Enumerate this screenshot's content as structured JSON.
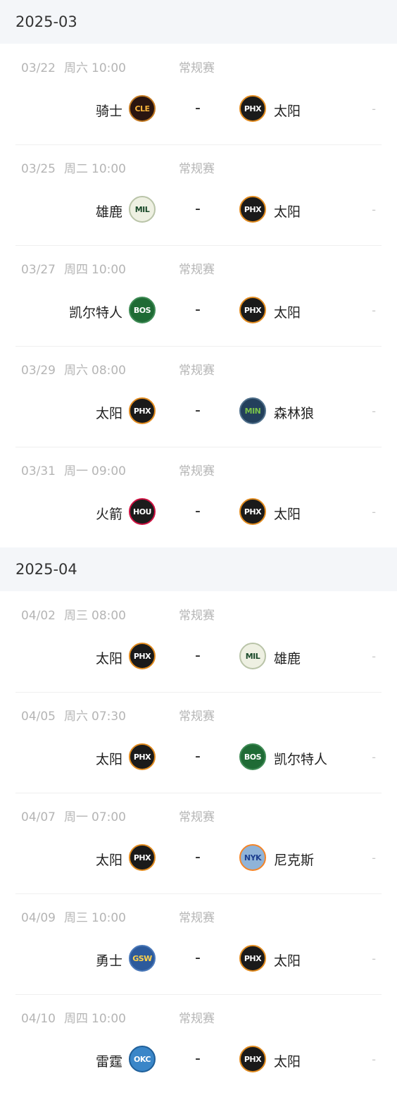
{
  "colors": {
    "CLE": {
      "bg": "#2a1510",
      "fg": "#f6b23a",
      "ring": "#c37a22"
    },
    "PHX": {
      "bg": "#1a1a1a",
      "fg": "#ffffff",
      "ring": "#e08a1e"
    },
    "MIL": {
      "bg": "#eef0e2",
      "fg": "#1b4a2a",
      "ring": "#b9c4a8"
    },
    "BOS": {
      "bg": "#1f6b35",
      "fg": "#ffffff",
      "ring": "#3f8b55"
    },
    "MIN": {
      "bg": "#23405c",
      "fg": "#79c24a",
      "ring": "#4f6f8a"
    },
    "HOU": {
      "bg": "#1c1c1c",
      "fg": "#ffffff",
      "ring": "#ce1141"
    },
    "NYK": {
      "bg": "#8fb3d8",
      "fg": "#1d3f8f",
      "ring": "#f58426"
    },
    "GSW": {
      "bg": "#2c5a9c",
      "fg": "#ffd24a",
      "ring": "#4a78b8"
    },
    "OKC": {
      "bg": "#3a86c8",
      "fg": "#ffffff",
      "ring": "#1f5f99"
    }
  },
  "months": [
    {
      "label": "2025-03",
      "games": [
        {
          "date": "03/22",
          "weekday": "周六",
          "time": "10:00",
          "type": "常规赛",
          "home": {
            "name": "骑士",
            "code": "CLE",
            "logo": "CLE"
          },
          "score": "-",
          "away": {
            "name": "太阳",
            "code": "PHX",
            "logo": "PHX"
          },
          "extra": "-"
        },
        {
          "date": "03/25",
          "weekday": "周二",
          "time": "10:00",
          "type": "常规赛",
          "home": {
            "name": "雄鹿",
            "code": "MIL",
            "logo": "MIL"
          },
          "score": "-",
          "away": {
            "name": "太阳",
            "code": "PHX",
            "logo": "PHX"
          },
          "extra": "-"
        },
        {
          "date": "03/27",
          "weekday": "周四",
          "time": "10:00",
          "type": "常规赛",
          "home": {
            "name": "凯尔特人",
            "code": "BOS",
            "logo": "BOS"
          },
          "score": "-",
          "away": {
            "name": "太阳",
            "code": "PHX",
            "logo": "PHX"
          },
          "extra": "-"
        },
        {
          "date": "03/29",
          "weekday": "周六",
          "time": "08:00",
          "type": "常规赛",
          "home": {
            "name": "太阳",
            "code": "PHX",
            "logo": "PHX"
          },
          "score": "-",
          "away": {
            "name": "森林狼",
            "code": "MIN",
            "logo": "MIN"
          },
          "extra": "-"
        },
        {
          "date": "03/31",
          "weekday": "周一",
          "time": "09:00",
          "type": "常规赛",
          "home": {
            "name": "火箭",
            "code": "HOU",
            "logo": "HOU"
          },
          "score": "-",
          "away": {
            "name": "太阳",
            "code": "PHX",
            "logo": "PHX"
          },
          "extra": "-"
        }
      ]
    },
    {
      "label": "2025-04",
      "games": [
        {
          "date": "04/02",
          "weekday": "周三",
          "time": "08:00",
          "type": "常规赛",
          "home": {
            "name": "太阳",
            "code": "PHX",
            "logo": "PHX"
          },
          "score": "-",
          "away": {
            "name": "雄鹿",
            "code": "MIL",
            "logo": "MIL"
          },
          "extra": "-"
        },
        {
          "date": "04/05",
          "weekday": "周六",
          "time": "07:30",
          "type": "常规赛",
          "home": {
            "name": "太阳",
            "code": "PHX",
            "logo": "PHX"
          },
          "score": "-",
          "away": {
            "name": "凯尔特人",
            "code": "BOS",
            "logo": "BOS"
          },
          "extra": "-"
        },
        {
          "date": "04/07",
          "weekday": "周一",
          "time": "07:00",
          "type": "常规赛",
          "home": {
            "name": "太阳",
            "code": "PHX",
            "logo": "PHX"
          },
          "score": "-",
          "away": {
            "name": "尼克斯",
            "code": "NYK",
            "logo": "NYK"
          },
          "extra": "-"
        },
        {
          "date": "04/09",
          "weekday": "周三",
          "time": "10:00",
          "type": "常规赛",
          "home": {
            "name": "勇士",
            "code": "GSW",
            "logo": "GSW"
          },
          "score": "-",
          "away": {
            "name": "太阳",
            "code": "PHX",
            "logo": "PHX"
          },
          "extra": "-"
        },
        {
          "date": "04/10",
          "weekday": "周四",
          "time": "10:00",
          "type": "常规赛",
          "home": {
            "name": "雷霆",
            "code": "OKC",
            "logo": "OKC"
          },
          "score": "-",
          "away": {
            "name": "太阳",
            "code": "PHX",
            "logo": "PHX"
          },
          "extra": "-"
        }
      ]
    }
  ]
}
